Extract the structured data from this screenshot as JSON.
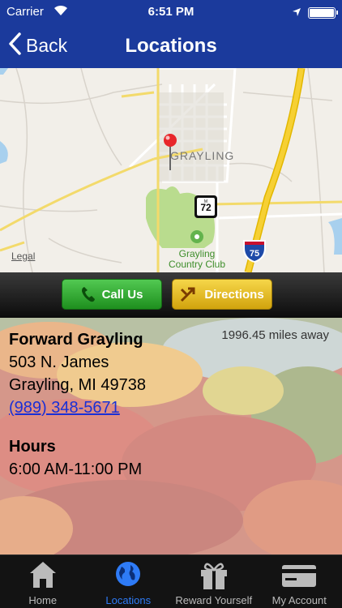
{
  "status": {
    "carrier": "Carrier",
    "time": "6:51 PM"
  },
  "nav": {
    "back_label": "Back",
    "title": "Locations"
  },
  "map": {
    "town_label": "GRAYLING",
    "route_72": "72",
    "route_75": "75",
    "park_label_1": "Grayling",
    "park_label_2": "Country Club",
    "legal": "Legal"
  },
  "actions": {
    "call_label": "Call Us",
    "directions_label": "Directions"
  },
  "location": {
    "name": "Forward Grayling",
    "distance": "1996.45 miles away",
    "address_line1": "503 N. James",
    "address_line2": "Grayling, MI 49738",
    "phone": "(989) 348-5671",
    "hours_title": "Hours",
    "hours": "6:00 AM-11:00 PM"
  },
  "tabs": [
    {
      "label": "Home",
      "icon": "house-icon"
    },
    {
      "label": "Locations",
      "icon": "globe-icon"
    },
    {
      "label": "Reward Yourself",
      "icon": "gift-icon"
    },
    {
      "label": "My Account",
      "icon": "credit-card-icon"
    }
  ],
  "colors": {
    "nav": "#1b3a9c",
    "call": "#2fa82f",
    "directions": "#e6bb22",
    "tab_active": "#2e7bf6",
    "link": "#1a2fd6"
  }
}
